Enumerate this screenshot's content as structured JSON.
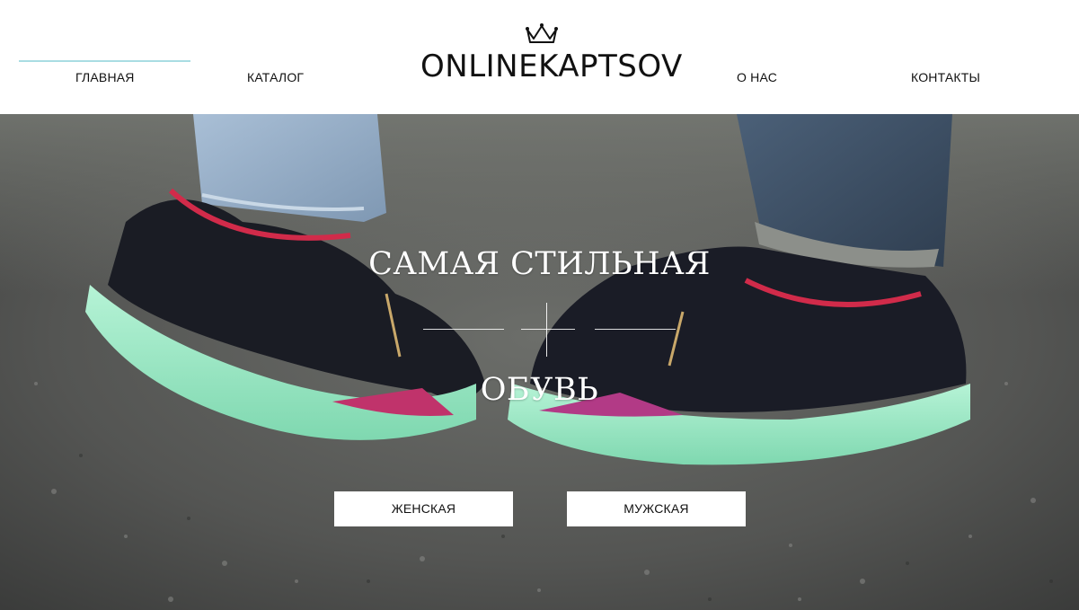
{
  "nav": {
    "left": [
      {
        "label": "ГЛАВНАЯ",
        "active": true
      },
      {
        "label": "КАТАЛОГ",
        "active": false
      }
    ],
    "right": [
      {
        "label": "О НАС",
        "active": false
      },
      {
        "label": "КОНТАКТЫ",
        "active": false
      }
    ]
  },
  "logo": {
    "text": "ONLINEKAPTSOV",
    "icon": "crown-icon"
  },
  "hero": {
    "image": "sneakers-photo",
    "title_line1": "САМАЯ СТИЛЬНАЯ",
    "title_line2": "ОБУВЬ",
    "buttons": {
      "women": "ЖЕНСКАЯ",
      "men": "МУЖСКАЯ"
    }
  },
  "colors": {
    "active_nav_underline": "#a9dde3",
    "button_bg": "#ffffff",
    "hero_text": "#ffffff"
  }
}
